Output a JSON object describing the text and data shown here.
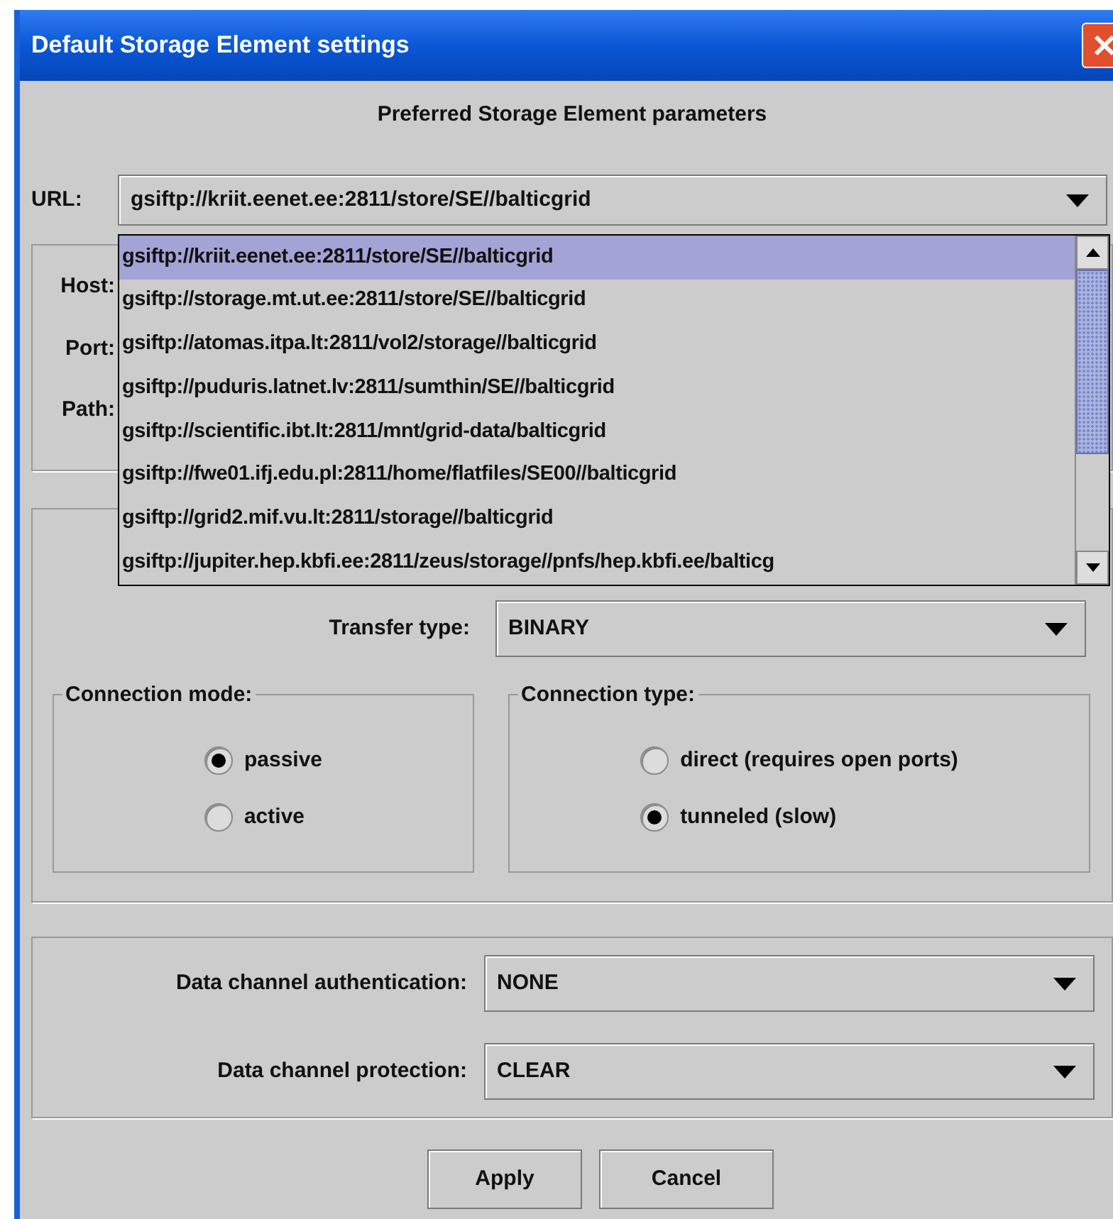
{
  "window": {
    "title": "Default Storage Element settings"
  },
  "heading": "Preferred Storage Element parameters",
  "url": {
    "label": "URL:",
    "value": "gsiftp://kriit.eenet.ee:2811/store/SE//balticgrid",
    "expanded": true,
    "options": [
      {
        "text": "gsiftp://kriit.eenet.ee:2811/store/SE//balticgrid",
        "selected": true
      },
      {
        "text": "gsiftp://storage.mt.ut.ee:2811/store/SE//balticgrid",
        "selected": false
      },
      {
        "text": "gsiftp://atomas.itpa.lt:2811/vol2/storage//balticgrid",
        "selected": false
      },
      {
        "text": "gsiftp://puduris.latnet.lv:2811/sumthin/SE//balticgrid",
        "selected": false
      },
      {
        "text": "gsiftp://scientific.ibt.lt:2811/mnt/grid-data/balticgrid",
        "selected": false
      },
      {
        "text": "gsiftp://fwe01.ifj.edu.pl:2811/home/flatfiles/SE00//balticgrid",
        "selected": false
      },
      {
        "text": "gsiftp://grid2.mif.vu.lt:2811/storage//balticgrid",
        "selected": false
      },
      {
        "text": "gsiftp://jupiter.hep.kbfi.ee:2811/zeus/storage//pnfs/hep.kbfi.ee/balticg",
        "selected": false
      }
    ]
  },
  "location_labels": [
    "Host:",
    "Port:",
    "Path:"
  ],
  "transfer_type": {
    "label": "Transfer type:",
    "value": "BINARY"
  },
  "groups": [
    {
      "title": "Connection mode:",
      "options": [
        {
          "label": "passive",
          "selected": true
        },
        {
          "label": "active",
          "selected": false
        }
      ]
    },
    {
      "title": "Connection type:",
      "options": [
        {
          "label": "direct (requires open ports)",
          "selected": false
        },
        {
          "label": "tunneled (slow)",
          "selected": true
        }
      ]
    }
  ],
  "auth": {
    "label": "Data channel authentication:",
    "value": "NONE"
  },
  "protection": {
    "label": "Data channel protection:",
    "value": "CLEAR"
  },
  "buttons": [
    "Apply",
    "Cancel"
  ]
}
